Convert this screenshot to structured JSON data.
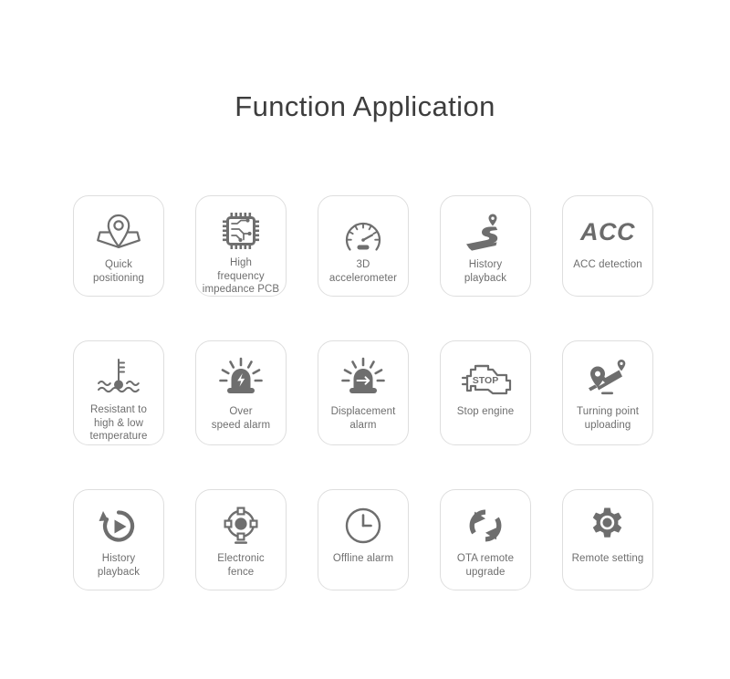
{
  "header": {
    "title": "Function Application"
  },
  "theme": {
    "background": "#ffffff",
    "card_border": "#dedede",
    "icon_color": "#6e6e6e",
    "label_color": "#6e6e6e",
    "title_color": "#3d3d3d"
  },
  "grid": {
    "columns": 5,
    "rows": 3,
    "rows_data": [
      {
        "cards": [
          {
            "icon": "map-pin-location-icon",
            "label": "Quick\npositioning"
          },
          {
            "icon": "chip-pcb-icon",
            "label": "High\nfrequency\nimpedance PCB"
          },
          {
            "icon": "speedometer-gauge-icon",
            "label": "3D\naccelerometer"
          },
          {
            "icon": "road-route-pin-icon",
            "label": "History\nplayback"
          },
          {
            "icon": "acc-text-icon",
            "icon_text": "ACC",
            "label": "ACC detection"
          }
        ]
      },
      {
        "cards": [
          {
            "icon": "thermometer-water-waves-icon",
            "label": "Resistant to\nhigh & low\ntemperature"
          },
          {
            "icon": "siren-alarm-speed-icon",
            "label": "Over\nspeed alarm"
          },
          {
            "icon": "siren-alarm-displacement-icon",
            "label": "Displacement\nalarm"
          },
          {
            "icon": "engine-stop-icon",
            "icon_text": "STOP",
            "label": "Stop engine"
          },
          {
            "icon": "turning-point-route-icon",
            "label": "Turning point\nuploading"
          }
        ]
      },
      {
        "cards": [
          {
            "icon": "replay-history-icon",
            "label": "History\nplayback"
          },
          {
            "icon": "electronic-fence-icon",
            "label": "Electronic\nfence"
          },
          {
            "icon": "clock-offline-icon",
            "label": "Offline alarm"
          },
          {
            "icon": "refresh-ota-icon",
            "label": "OTA remote\nupgrade"
          },
          {
            "icon": "gear-settings-icon",
            "label": "Remote setting"
          }
        ]
      }
    ]
  }
}
